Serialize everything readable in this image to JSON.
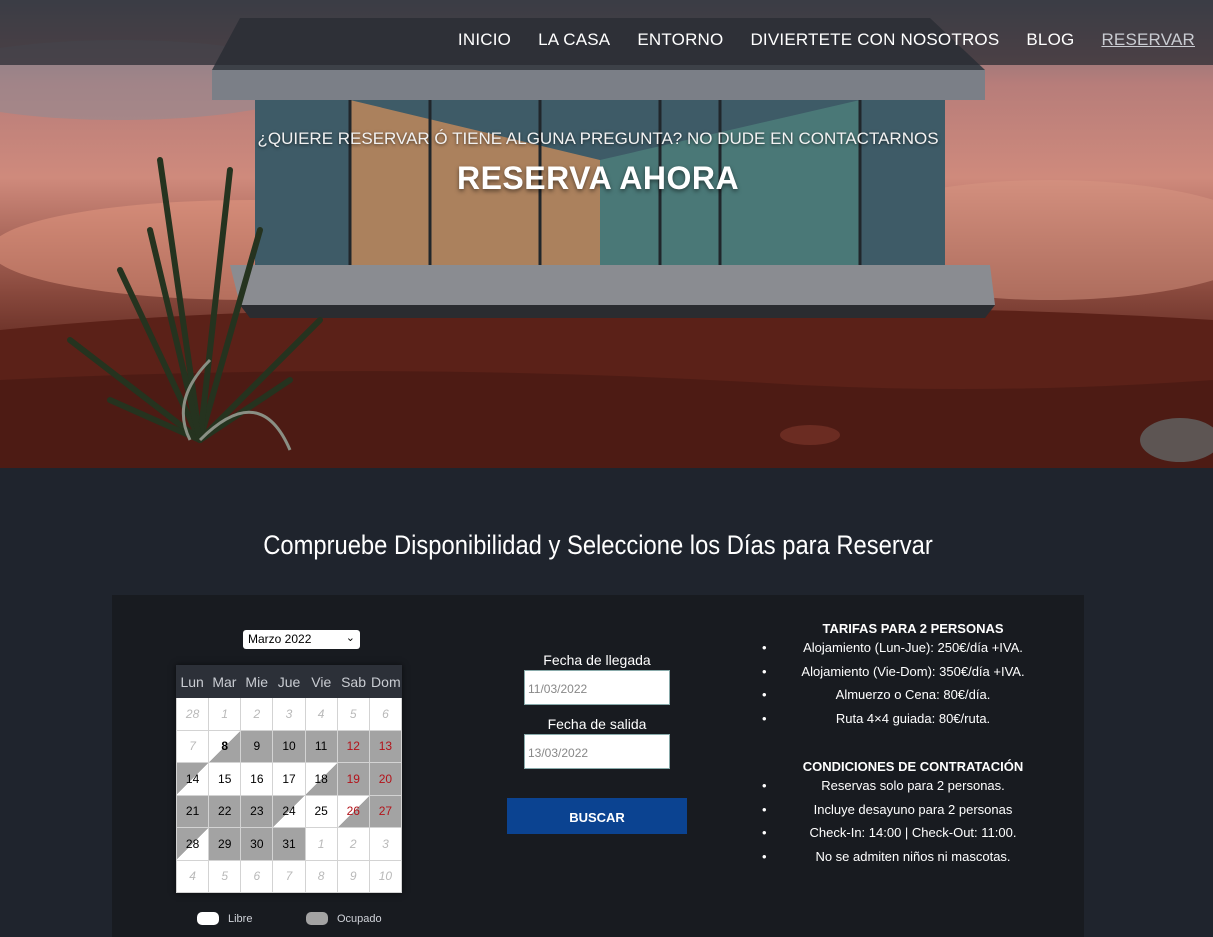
{
  "nav": {
    "items": [
      {
        "label": "INICIO",
        "active": false
      },
      {
        "label": "LA CASA",
        "active": false
      },
      {
        "label": "ENTORNO",
        "active": false
      },
      {
        "label": "DIVIERTETE CON NOSOTROS",
        "active": false
      },
      {
        "label": "BLOG",
        "active": false
      },
      {
        "label": "RESERVAR",
        "active": true
      }
    ]
  },
  "hero": {
    "subtitle": "¿QUIERE RESERVAR Ó TIENE ALGUNA PREGUNTA? NO DUDE EN CONTACTARNOS",
    "title": "RESERVA AHORA"
  },
  "section_title": "Compruebe Disponibilidad y Seleccione los Días para Reservar",
  "calendar": {
    "month_select": "Marzo 2022",
    "weekdays": [
      "Lun",
      "Mar",
      "Mie",
      "Jue",
      "Vie",
      "Sab",
      "Dom"
    ],
    "weeks": [
      [
        {
          "d": "28",
          "s": "other"
        },
        {
          "d": "1",
          "s": "other"
        },
        {
          "d": "2",
          "s": "other"
        },
        {
          "d": "3",
          "s": "other"
        },
        {
          "d": "4",
          "s": "other"
        },
        {
          "d": "5",
          "s": "other"
        },
        {
          "d": "6",
          "s": "other"
        }
      ],
      [
        {
          "d": "7",
          "s": "other"
        },
        {
          "d": "8",
          "s": "half-start today"
        },
        {
          "d": "9",
          "s": "busy"
        },
        {
          "d": "10",
          "s": "busy"
        },
        {
          "d": "11",
          "s": "busy"
        },
        {
          "d": "12",
          "s": "busy weekend"
        },
        {
          "d": "13",
          "s": "busy weekend"
        }
      ],
      [
        {
          "d": "14",
          "s": "half-end"
        },
        {
          "d": "15",
          "s": "free"
        },
        {
          "d": "16",
          "s": "free"
        },
        {
          "d": "17",
          "s": "free"
        },
        {
          "d": "18",
          "s": "half-start"
        },
        {
          "d": "19",
          "s": "busy weekend"
        },
        {
          "d": "20",
          "s": "busy weekend"
        }
      ],
      [
        {
          "d": "21",
          "s": "busy"
        },
        {
          "d": "22",
          "s": "busy"
        },
        {
          "d": "23",
          "s": "busy"
        },
        {
          "d": "24",
          "s": "half-end"
        },
        {
          "d": "25",
          "s": "free"
        },
        {
          "d": "26",
          "s": "half-start weekend"
        },
        {
          "d": "27",
          "s": "busy weekend"
        }
      ],
      [
        {
          "d": "28",
          "s": "half-end"
        },
        {
          "d": "29",
          "s": "busy"
        },
        {
          "d": "30",
          "s": "busy"
        },
        {
          "d": "31",
          "s": "busy"
        },
        {
          "d": "1",
          "s": "other"
        },
        {
          "d": "2",
          "s": "other"
        },
        {
          "d": "3",
          "s": "other"
        }
      ],
      [
        {
          "d": "4",
          "s": "other"
        },
        {
          "d": "5",
          "s": "other"
        },
        {
          "d": "6",
          "s": "other"
        },
        {
          "d": "7",
          "s": "other"
        },
        {
          "d": "8",
          "s": "other"
        },
        {
          "d": "9",
          "s": "other"
        },
        {
          "d": "10",
          "s": "other"
        }
      ]
    ],
    "legend_free": "Libre",
    "legend_busy": "Ocupado",
    "colors": {
      "free": "#ffffff",
      "busy": "#a3a3a3",
      "weekend_text": "#b3131a"
    }
  },
  "form": {
    "arrival_label": "Fecha de llegada",
    "arrival_value": "11/03/2022",
    "departure_label": "Fecha de salida",
    "departure_value": "13/03/2022",
    "search_button": "BUSCAR",
    "button_color": "#0b4391"
  },
  "rates": {
    "title": "TARIFAS PARA 2 PERSONAS",
    "items": [
      "Alojamiento (Lun-Jue): 250€/día +IVA.",
      "Alojamiento (Vie-Dom): 350€/día +IVA.",
      "Almuerzo o Cena: 80€/día.",
      "Ruta 4×4 guiada: 80€/ruta."
    ]
  },
  "conditions": {
    "title": "CONDICIONES DE CONTRATACIÓN",
    "items": [
      "Reservas solo para 2 personas.",
      "Incluye desayuno para 2 personas",
      "Check-In: 14:00 | Check-Out: 11:00.",
      "No se admiten niños ni mascotas."
    ]
  }
}
